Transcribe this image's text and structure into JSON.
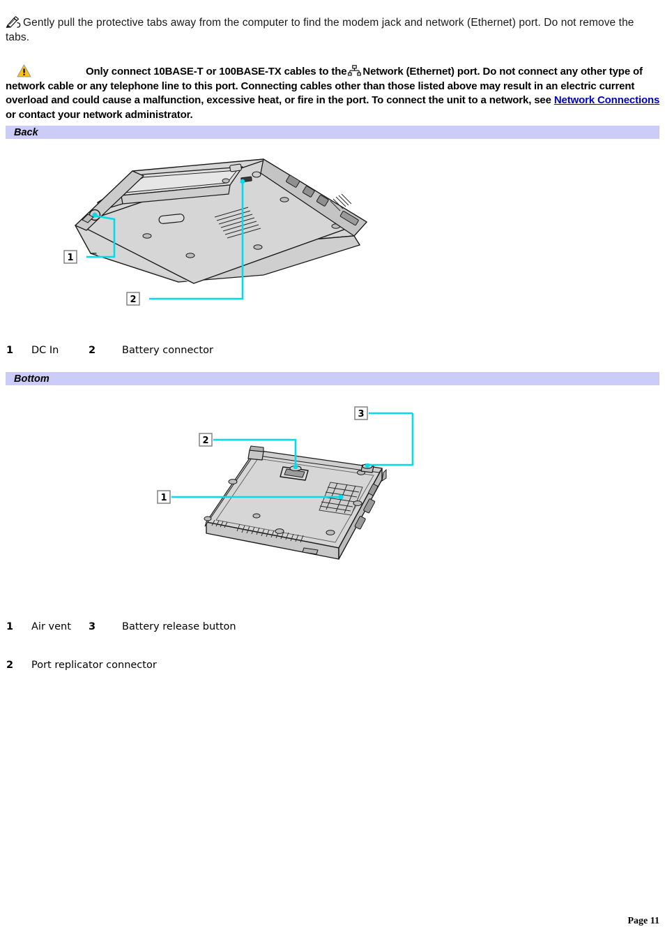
{
  "note": {
    "icon": "note-pencil-icon",
    "text": "Gently pull the protective tabs away from the computer to find the modem jack and network (Ethernet) port. Do not remove the tabs."
  },
  "warning": {
    "icon": "warning-triangle-icon",
    "inline_icon": "network-ethernet-icon",
    "text_before_icon": "Only connect 10BASE-T or 100BASE-TX cables to the",
    "text_after_icon": "Network (Ethernet) port. Do not connect any other type of network cable or any telephone line to this port. Connecting cables other than those listed above may result in an electric current overload and could cause a malfunction, excessive heat, or fire in the port. To connect the unit to a network, see",
    "link_text": "Network Connections",
    "text_after_link": "or contact your network administrator.",
    "link_color": "#0000cc"
  },
  "sections": {
    "back": {
      "title": "Back",
      "bar_color": "#ccccf8",
      "figure_alt": "Rear view of notebook computer showing DC In and battery connector",
      "callouts": [
        {
          "number": "1",
          "label": "DC In"
        },
        {
          "number": "2",
          "label": "Battery connector"
        }
      ]
    },
    "bottom": {
      "title": "Bottom",
      "bar_color": "#ccccf8",
      "figure_alt": "Bottom view of notebook computer showing air vent, port replicator connector and battery release button",
      "callouts": [
        {
          "number": "1",
          "label": "Air vent"
        },
        {
          "number": "3",
          "label": "Battery release button"
        },
        {
          "number": "2",
          "label": "Port replicator connector"
        }
      ]
    }
  },
  "figure_colors": {
    "callout_line": "#00dcec",
    "body_fill": "#d6d6d6",
    "body_fill_dark": "#b9b9b9",
    "body_fill_light": "#e4e4e4",
    "outline": "#1a1a1a",
    "callout_box_border": "#808080"
  },
  "footer": {
    "page_label": "Page 11"
  }
}
